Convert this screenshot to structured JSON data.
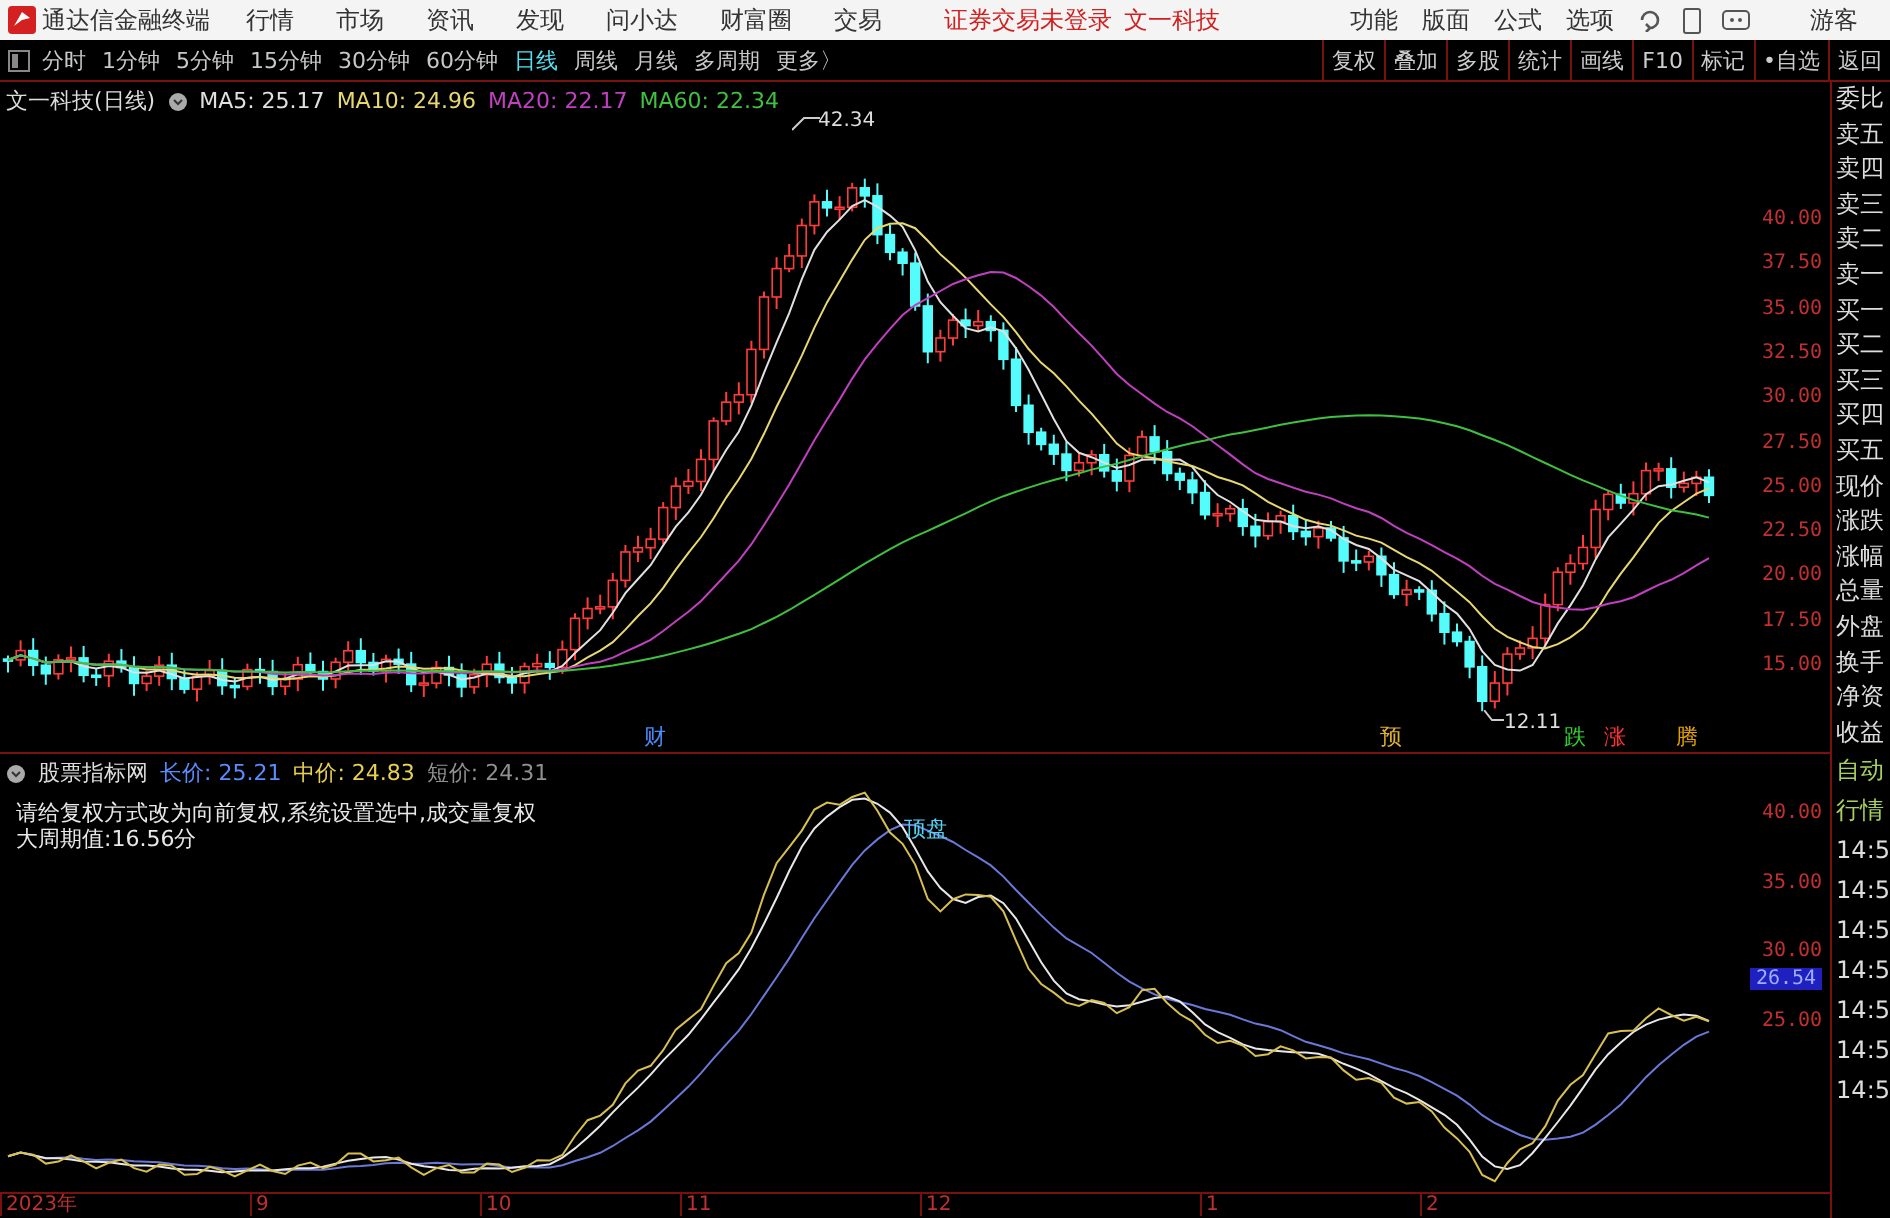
{
  "app": {
    "title": "通达信金融终端",
    "menus": [
      "行情",
      "市场",
      "资讯",
      "发现",
      "问小达",
      "财富圈",
      "交易"
    ],
    "notice": "证券交易未登录",
    "stock_link": "文一科技",
    "right_menus": [
      "功能",
      "版面",
      "公式",
      "选项"
    ],
    "user": "游客"
  },
  "periods": [
    {
      "label": "分时",
      "selected": false
    },
    {
      "label": "1分钟",
      "selected": false
    },
    {
      "label": "5分钟",
      "selected": false
    },
    {
      "label": "15分钟",
      "selected": false
    },
    {
      "label": "30分钟",
      "selected": false
    },
    {
      "label": "60分钟",
      "selected": false
    },
    {
      "label": "日线",
      "selected": true
    },
    {
      "label": "周线",
      "selected": false
    },
    {
      "label": "月线",
      "selected": false
    },
    {
      "label": "多周期",
      "selected": false
    },
    {
      "label": "更多〉",
      "selected": false
    }
  ],
  "tools": [
    "复权",
    "叠加",
    "多股",
    "统计",
    "画线",
    "F10",
    "标记",
    "•自选",
    "返回"
  ],
  "main_chart": {
    "title": "文一科技(日线)",
    "legend": [
      {
        "label": "MA5: 25.17",
        "color": "#e0e0e0"
      },
      {
        "label": "MA10: 24.96",
        "color": "#e8d870"
      },
      {
        "label": "MA20: 22.17",
        "color": "#c040c0"
      },
      {
        "label": "MA60: 22.34",
        "color": "#40c040"
      }
    ],
    "yticks": [
      "40.00",
      "37.50",
      "35.00",
      "32.50",
      "30.00",
      "27.50",
      "25.00",
      "22.50",
      "20.00",
      "17.50",
      "15.00"
    ],
    "high_label": "42.34",
    "low_label": "12.11",
    "markers": [
      {
        "label": "财",
        "color": "#4a8cff"
      },
      {
        "label": "预",
        "color": "#e0b030"
      },
      {
        "label": "跌",
        "color": "#30d030"
      },
      {
        "label": "涨",
        "color": "#ff3030"
      },
      {
        "label": "腾",
        "color": "#e0a000"
      }
    ]
  },
  "indicator": {
    "title": "股票指标网",
    "legend": [
      {
        "label": "长价: 25.21",
        "color": "#5a8cff"
      },
      {
        "label": "中价: 24.83",
        "color": "#e8d050"
      },
      {
        "label": "短价: 24.31",
        "color": "#909090"
      }
    ],
    "notes": [
      "请给复权方式改为向前复权,系统设置选中,成交量复权",
      "大周期值:16.56分"
    ],
    "peak_label": "顶盘",
    "yticks": [
      "40.00",
      "35.00",
      "30.00",
      "25.00"
    ],
    "current": "26.54"
  },
  "xaxis": [
    "2023年",
    "9",
    "10",
    "11",
    "12",
    "1",
    "2"
  ],
  "side_labels": [
    "委比",
    "卖五",
    "卖四",
    "卖三",
    "卖二",
    "卖一",
    "买一",
    "买二",
    "买三",
    "买四",
    "买五",
    "现价",
    "涨跌",
    "涨幅",
    "总量",
    "外盘",
    "换手",
    "净资",
    "收益"
  ],
  "side_lower": [
    "自动",
    "行情",
    "14:5",
    "14:5",
    "14:5",
    "14:5",
    "14:5",
    "14:5",
    "14:5"
  ]
}
